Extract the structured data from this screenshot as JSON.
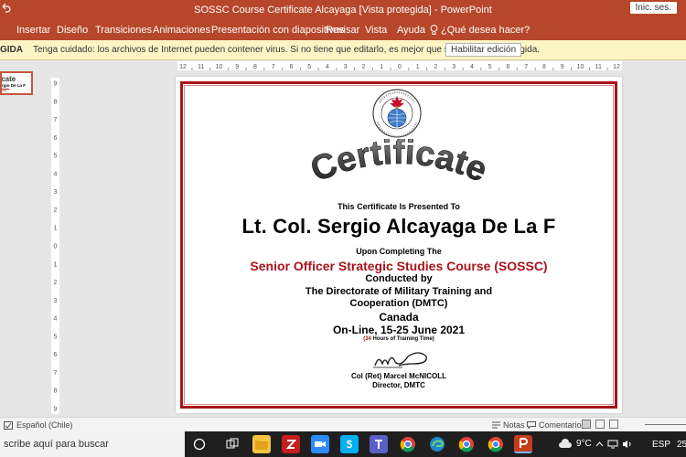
{
  "window": {
    "title": "SOSSC Course Certificate Alcayaga [Vista protegida]  -  PowerPoint",
    "sign_in": "Inic. ses."
  },
  "ribbon": {
    "tabs": [
      "Insertar",
      "Diseño",
      "Transiciones",
      "Animaciones",
      "Presentación con diapositivas",
      "Revisar",
      "Vista",
      "Ayuda"
    ],
    "tell_me": "¿Qué desea hacer?"
  },
  "protected_view": {
    "label": "GIDA",
    "message": "Tenga cuidado: los archivos de Internet pueden contener virus. Si no tiene que editarlo, es mejor que siga en Vista protegida.",
    "enable_button": "Habilitar edición"
  },
  "ruler": {
    "horizontal": [
      "12",
      "11",
      "10",
      "9",
      "8",
      "7",
      "6",
      "5",
      "4",
      "3",
      "2",
      "1",
      "0",
      "1",
      "2",
      "3",
      "4",
      "5",
      "6",
      "7",
      "8",
      "9",
      "10",
      "11",
      "12"
    ],
    "vertical": [
      "9",
      "8",
      "7",
      "6",
      "5",
      "4",
      "3",
      "2",
      "1",
      "0",
      "1",
      "2",
      "3",
      "4",
      "5",
      "6",
      "7",
      "8",
      "9"
    ]
  },
  "certificate": {
    "heading": "Certificate",
    "presented_to": "This Certificate Is Presented To",
    "recipient": "Lt. Col. Sergio Alcayaga De La F",
    "upon_completing": "Upon Completing The",
    "course": "Senior Officer Strategic Studies Course (SOSSC)",
    "conducted_by": "Conducted by",
    "directorate_line1": "The Directorate of Military Training and",
    "directorate_line2": "Cooperation (DMTC)",
    "country": "Canada",
    "dates": "On-Line, 15-25 June 2021",
    "hours_open": "(",
    "hours_value": "34",
    "hours_text": " Hours of Training Time)",
    "signer": "Col (Ret) Marcel McNICOLL",
    "signer_title": "Director, DMTC",
    "accent_color": "#a8131b"
  },
  "statusbar": {
    "language": "Español (Chile)",
    "notes": "Notas",
    "comments": "Comentarios"
  },
  "taskbar": {
    "search": "scribe aquí para buscar",
    "weather": "9°C",
    "language": "ESP",
    "clock": "25"
  }
}
